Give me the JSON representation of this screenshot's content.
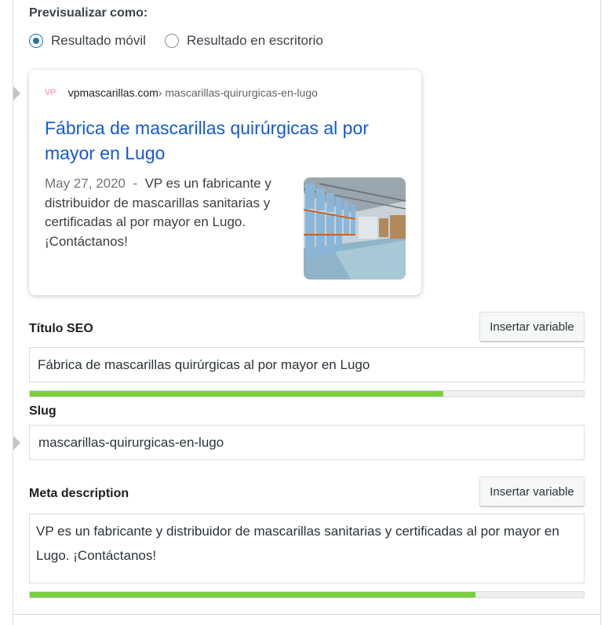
{
  "preview": {
    "label": "Previsualizar como:",
    "options": [
      {
        "label": "Resultado móvil",
        "selected": true
      },
      {
        "label": "Resultado en escritorio",
        "selected": false
      }
    ]
  },
  "serp": {
    "favicon_text": "VP",
    "site": "vpmascarillas.com",
    "path": " › mascarillas-quirurgicas-en-lugo",
    "title": "Fábrica de mascarillas quirúrgicas al por mayor en Lugo",
    "date": "May 27, 2020",
    "date_separator": "  -  ",
    "description": "VP es un fabricante y distribuidor de mascarillas sanitarias y certificadas al por mayor en Lugo. ¡Contáctanos!"
  },
  "seo_title": {
    "label": "Título SEO",
    "button": "Insertar variable",
    "value": "Fábrica de mascarillas quirúrgicas al por mayor en Lugo",
    "progress": 0.746
  },
  "slug": {
    "label": "Slug",
    "value": "mascarillas-quirurgicas-en-lugo"
  },
  "meta_description": {
    "label": "Meta description",
    "button": "Insertar variable",
    "value": "VP es un fabricante y distribuidor de mascarillas sanitarias y certificadas al por mayor en Lugo. ¡Contáctanos!",
    "progress": 0.805
  },
  "colors": {
    "accent": "#2271b1",
    "link": "#1558d6",
    "progress_good": "#7ad03a"
  }
}
